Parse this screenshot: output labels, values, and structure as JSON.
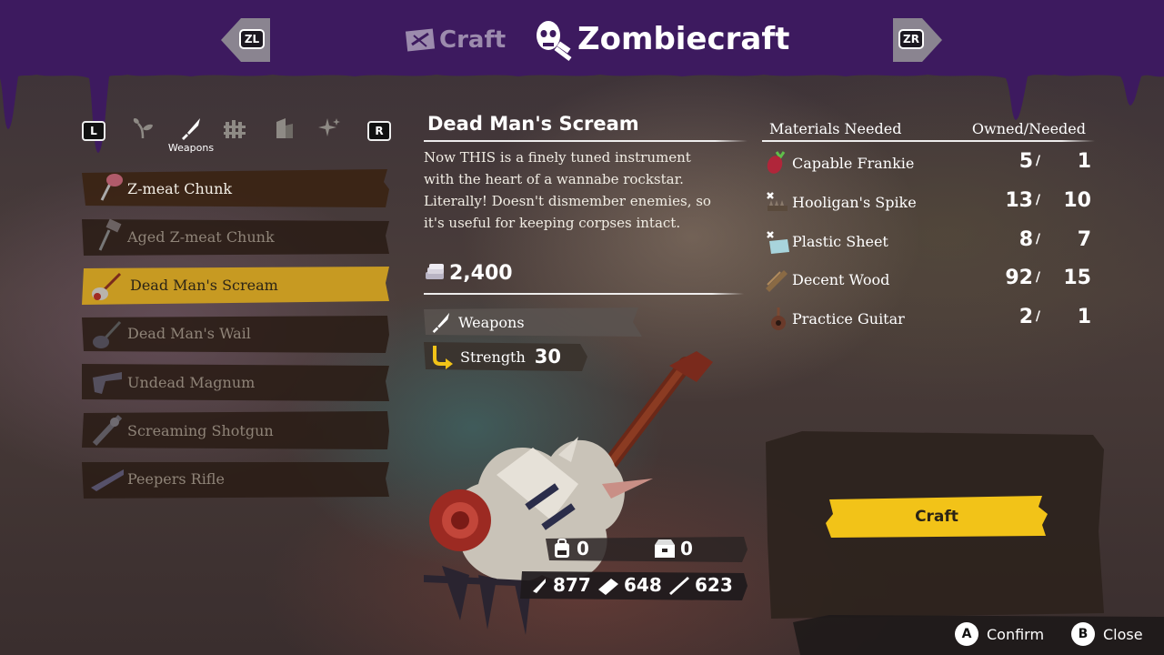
{
  "header": {
    "prev_button": "ZL",
    "next_button": "ZR",
    "tabs": [
      {
        "label": "Craft",
        "active": false
      },
      {
        "label": "Zombiecraft",
        "active": true
      }
    ]
  },
  "category_bar": {
    "left_button": "L",
    "right_button": "R",
    "categories": [
      {
        "icon": "sprout-icon"
      },
      {
        "icon": "knife-icon",
        "label": "Weapons",
        "active": true
      },
      {
        "icon": "fence-icon"
      },
      {
        "icon": "building-icon"
      },
      {
        "icon": "sparkle-icon"
      }
    ]
  },
  "recipes": [
    {
      "name": "Z-meat Chunk",
      "state": "normal"
    },
    {
      "name": "Aged Z-meat Chunk",
      "state": "dim"
    },
    {
      "name": "Dead Man's Scream",
      "state": "selected"
    },
    {
      "name": "Dead Man's Wail",
      "state": "dim"
    },
    {
      "name": "Undead Magnum",
      "state": "dim"
    },
    {
      "name": "Screaming Shotgun",
      "state": "dim"
    },
    {
      "name": "Peepers Rifle",
      "state": "dim"
    }
  ],
  "detail": {
    "title": "Dead Man's Scream",
    "description_lines": [
      "Now THIS is a finely tuned instrument",
      "with the heart of a wannabe rockstar.",
      "Literally! Doesn't dismember enemies, so",
      "it's useful for keeping corpses intact."
    ],
    "price": "2,400",
    "category": "Weapons",
    "stat_label": "Strength",
    "stat_value": "30",
    "carried": "0",
    "stored": "0",
    "ammo": [
      "877",
      "648",
      "623"
    ]
  },
  "materials": {
    "header_name": "Materials Needed",
    "header_count": "Owned/Needed",
    "rows": [
      {
        "name": "Capable Frankie",
        "owned": "5",
        "needed": "1",
        "icon": "radish-icon"
      },
      {
        "name": "Hooligan's Spike",
        "owned": "13",
        "needed": "10",
        "icon": "spike-icon"
      },
      {
        "name": "Plastic Sheet",
        "owned": "8",
        "needed": "7",
        "icon": "sheet-icon"
      },
      {
        "name": "Decent Wood",
        "owned": "92",
        "needed": "15",
        "icon": "wood-icon"
      },
      {
        "name": "Practice Guitar",
        "owned": "2",
        "needed": "1",
        "icon": "guitar-icon"
      }
    ]
  },
  "craft_button": "Craft",
  "footer": {
    "confirm_key": "A",
    "confirm_label": "Confirm",
    "close_key": "B",
    "close_label": "Close"
  },
  "colors": {
    "banner": "#3d1a5f",
    "selected_row": "#c79a22",
    "craft_button": "#f2c318"
  }
}
